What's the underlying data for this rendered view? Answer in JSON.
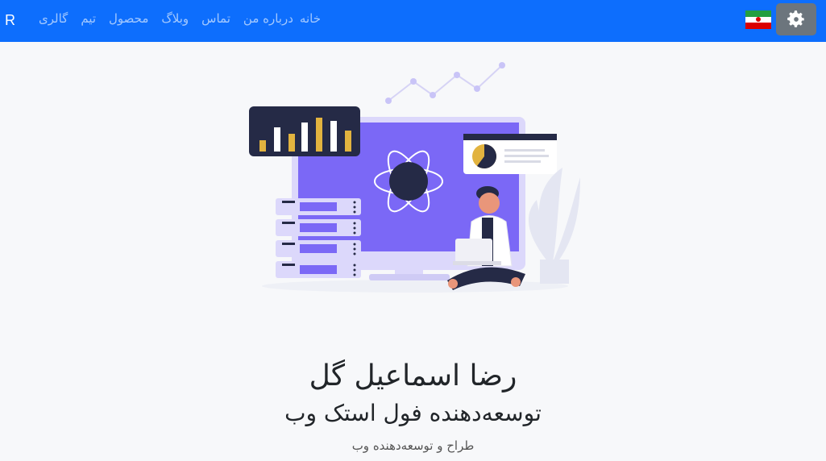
{
  "navbar": {
    "brand": "R",
    "links": [
      "خانه",
      "درباره من",
      "تماس",
      "وبلاگ",
      "محصول",
      "تیم",
      "گالری"
    ],
    "flag": "iran-flag-icon",
    "settings": "gear-icon",
    "background": "#0d6efd"
  },
  "hero": {
    "illustration": "developer-illustration",
    "name": "رضا اسماعیل گل",
    "role": "توسعه‌دهنده فول استک وب",
    "tagline": "طراح و توسعه‌دهنده وب"
  }
}
